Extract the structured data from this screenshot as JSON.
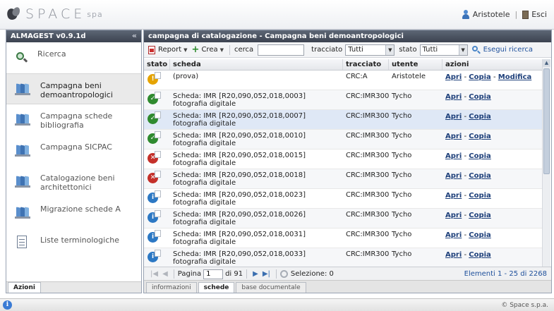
{
  "header": {
    "logo_text": "SPACE",
    "logo_sub": "spa",
    "user_name": "Aristotele",
    "separator": "|",
    "exit_label": "Esci"
  },
  "left_panel": {
    "title": "ALMAGEST v0.9.1d",
    "collapse_glyph": "«",
    "items": [
      {
        "label": "Ricerca",
        "icon": "search-icon"
      },
      {
        "label": "Campagna beni demoantropologici",
        "icon": "books-icon",
        "active": true
      },
      {
        "label": "Campagna schede bibliografia",
        "icon": "books-icon"
      },
      {
        "label": "Campagna SICPAC",
        "icon": "books-icon"
      },
      {
        "label": "Catalogazione beni architettonici",
        "icon": "books-icon"
      },
      {
        "label": "Migrazione schede A",
        "icon": "books-icon"
      },
      {
        "label": "Liste terminologiche",
        "icon": "document-icon"
      }
    ],
    "bottom_tab": "Azioni"
  },
  "right_panel": {
    "title": "campagna di catalogazione - Campagna beni demoantropologici",
    "toolbar": {
      "report_label": "Report",
      "crea_label": "Crea",
      "cerca_label": "cerca",
      "cerca_value": "",
      "tracciato_label": "tracciato",
      "tracciato_value": "Tutti",
      "stato_label": "stato",
      "stato_value": "Tutti",
      "search_button": "Esegui ricerca"
    },
    "columns": [
      "stato",
      "scheda",
      "tracciato",
      "utente",
      "azioni"
    ],
    "rows": [
      {
        "status": "yellow",
        "status_glyph": "!",
        "scheda": "(prova)",
        "tracciato": "CRC:A",
        "utente": "Aristotele",
        "azioni": [
          "Apri",
          "Copia",
          "Modifica"
        ]
      },
      {
        "status": "green",
        "status_glyph": "✓",
        "scheda": "Scheda: IMR [R20,090,052,018,0003] fotografia digitale",
        "tracciato": "CRC:IMR300",
        "utente": "Tycho",
        "azioni": [
          "Apri",
          "Copia"
        ]
      },
      {
        "status": "green",
        "status_glyph": "✓",
        "scheda": "Scheda: IMR [R20,090,052,018,0007] fotografia digitale",
        "tracciato": "CRC:IMR300",
        "utente": "Tycho",
        "azioni": [
          "Apri",
          "Copia"
        ],
        "selected": true
      },
      {
        "status": "green",
        "status_glyph": "✓",
        "scheda": "Scheda: IMR [R20,090,052,018,0010] fotografia digitale",
        "tracciato": "CRC:IMR300",
        "utente": "Tycho",
        "azioni": [
          "Apri",
          "Copia"
        ]
      },
      {
        "status": "red",
        "status_glyph": "✕",
        "scheda": "Scheda: IMR [R20,090,052,018,0015] fotografia digitale",
        "tracciato": "CRC:IMR300",
        "utente": "Tycho",
        "azioni": [
          "Apri",
          "Copia"
        ]
      },
      {
        "status": "red",
        "status_glyph": "✕",
        "scheda": "Scheda: IMR [R20,090,052,018,0018] fotografia digitale",
        "tracciato": "CRC:IMR300",
        "utente": "Tycho",
        "azioni": [
          "Apri",
          "Copia"
        ]
      },
      {
        "status": "blue",
        "status_glyph": "i",
        "scheda": "Scheda: IMR [R20,090,052,018,0023] fotografia digitale",
        "tracciato": "CRC:IMR300",
        "utente": "Tycho",
        "azioni": [
          "Apri",
          "Copia"
        ]
      },
      {
        "status": "blue",
        "status_glyph": "i",
        "scheda": "Scheda: IMR [R20,090,052,018,0026] fotografia digitale",
        "tracciato": "CRC:IMR300",
        "utente": "Tycho",
        "azioni": [
          "Apri",
          "Copia"
        ]
      },
      {
        "status": "blue",
        "status_glyph": "i",
        "scheda": "Scheda: IMR [R20,090,052,018,0031] fotografia digitale",
        "tracciato": "CRC:IMR300",
        "utente": "Tycho",
        "azioni": [
          "Apri",
          "Copia"
        ]
      },
      {
        "status": "blue",
        "status_glyph": "i",
        "scheda": "Scheda: IMR [R20,090,052,018,0033] fotografia digitale",
        "tracciato": "CRC:IMR300",
        "utente": "Tycho",
        "azioni": [
          "Apri",
          "Copia"
        ]
      }
    ],
    "pager": {
      "page_label": "Pagina",
      "page_value": "1",
      "of_label": "di 91",
      "selection_label": "Selezione: 0",
      "elements_label": "Elementi 1 - 25 di 2268"
    },
    "tabs": [
      {
        "label": "informazioni",
        "active": false
      },
      {
        "label": "schede",
        "active": true
      },
      {
        "label": "base documentale",
        "active": false
      }
    ]
  },
  "statusbar": {
    "copyright": "© Space s.p.a."
  },
  "colors": {
    "header_dark": "#3c4350",
    "link": "#1d3f7a",
    "status_yellow": "#e5a300",
    "status_green": "#2f8a2f",
    "status_red": "#c4302a",
    "status_blue": "#2c78c4",
    "selected_row": "#dfe8f6"
  }
}
